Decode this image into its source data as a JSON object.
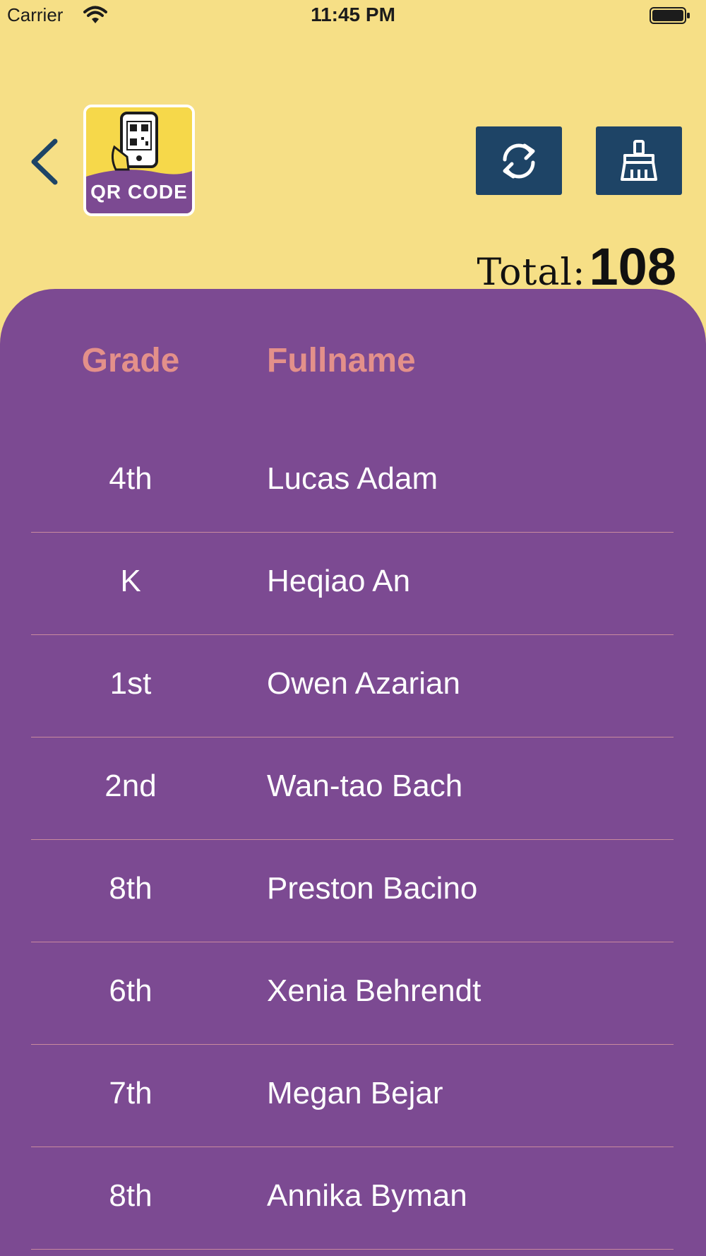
{
  "status_bar": {
    "carrier": "Carrier",
    "time": "11:45 PM",
    "icons": [
      "wifi-icon",
      "battery-icon"
    ]
  },
  "header": {
    "back_icon": "chevron-left-icon",
    "logo_text": "QR CODE",
    "refresh_icon": "refresh-icon",
    "clear_icon": "broom-icon",
    "total_label": "Total",
    "total_colon": ":",
    "total_value": "108"
  },
  "table": {
    "columns": {
      "grade": "Grade",
      "fullname": "Fullname"
    },
    "rows": [
      {
        "grade": "4th",
        "name": "Lucas Adam"
      },
      {
        "grade": "K",
        "name": "Heqiao An"
      },
      {
        "grade": "1st",
        "name": "Owen Azarian"
      },
      {
        "grade": "2nd",
        "name": "Wan-tao Bach"
      },
      {
        "grade": "8th",
        "name": "Preston Bacino"
      },
      {
        "grade": "6th",
        "name": "Xenia Behrendt"
      },
      {
        "grade": "7th",
        "name": "Megan Bejar"
      },
      {
        "grade": "8th",
        "name": "Annika Byman"
      }
    ]
  },
  "colors": {
    "background": "#f6df86",
    "panel": "#7c4a92",
    "button": "#1e4466",
    "header_text": "#e3908a",
    "row_text": "#ffffff",
    "divider": "#c98a9e"
  }
}
